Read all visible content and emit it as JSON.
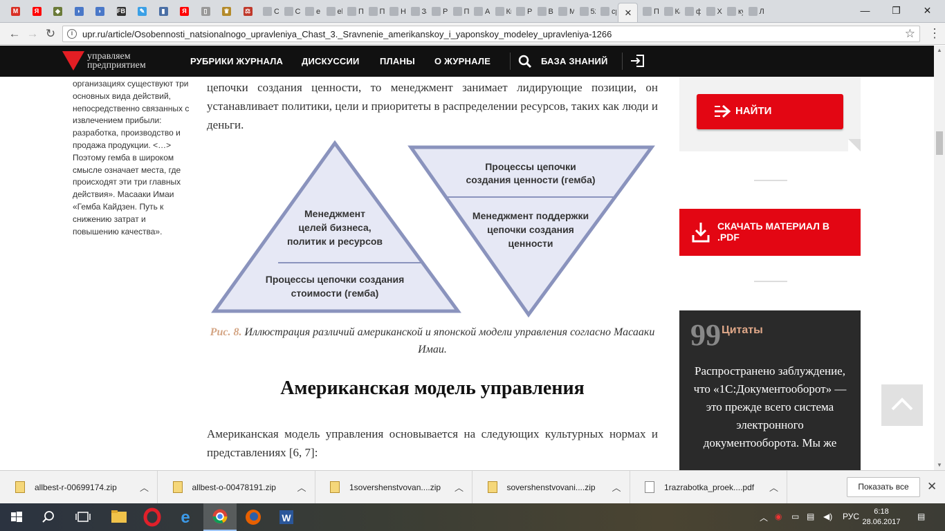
{
  "browser": {
    "tabs": [
      {
        "label": "",
        "icon": "gmail-icon",
        "color": "#d93025",
        "glyph": "M"
      },
      {
        "label": "",
        "icon": "yandex-icon",
        "color": "#ff0000",
        "glyph": "Я"
      },
      {
        "label": "",
        "icon": "shield-icon",
        "color": "#6b7b3a",
        "glyph": "◆"
      },
      {
        "label": "",
        "icon": "shield-blue-icon",
        "color": "#4a78c8",
        "glyph": "◗"
      },
      {
        "label": "",
        "icon": "shield-blue-icon",
        "color": "#4a78c8",
        "glyph": "◗"
      },
      {
        "label": "",
        "icon": "fb-icon",
        "color": "#333333",
        "glyph": "FB"
      },
      {
        "label": "",
        "icon": "pencil-icon",
        "color": "#3ba0e6",
        "glyph": "✎"
      },
      {
        "label": "",
        "icon": "bookmark-icon",
        "color": "#4a6fa5",
        "glyph": "▮"
      },
      {
        "label": "",
        "icon": "yandex-icon",
        "color": "#ff0000",
        "glyph": "Я"
      },
      {
        "label": "",
        "icon": "page-icon",
        "color": "#999999",
        "glyph": "▯"
      },
      {
        "label": "",
        "icon": "emblem-icon",
        "color": "#b48a2a",
        "glyph": "♛"
      },
      {
        "label": "",
        "icon": "scales-icon",
        "color": "#c0392b",
        "glyph": "⚖"
      },
      {
        "label": "Ст",
        "icon": "",
        "color": "",
        "glyph": ""
      },
      {
        "label": "Си",
        "icon": "",
        "color": "",
        "glyph": ""
      },
      {
        "label": "eL",
        "icon": "",
        "color": "",
        "glyph": ""
      },
      {
        "label": "eli",
        "icon": "",
        "color": "",
        "glyph": ""
      },
      {
        "label": "По",
        "icon": "",
        "color": "",
        "glyph": ""
      },
      {
        "label": "По",
        "icon": "",
        "color": "",
        "glyph": ""
      },
      {
        "label": "На",
        "icon": "",
        "color": "",
        "glyph": ""
      },
      {
        "label": "За",
        "icon": "",
        "color": "",
        "glyph": ""
      },
      {
        "label": "Ра",
        "icon": "",
        "color": "",
        "glyph": ""
      },
      {
        "label": "Пр",
        "icon": "",
        "color": "",
        "glyph": ""
      },
      {
        "label": "Ак",
        "icon": "",
        "color": "",
        "glyph": ""
      },
      {
        "label": "Ки",
        "icon": "",
        "color": "",
        "glyph": ""
      },
      {
        "label": "Ре",
        "icon": "",
        "color": "",
        "glyph": ""
      },
      {
        "label": "Вы",
        "icon": "",
        "color": "",
        "glyph": ""
      },
      {
        "label": "Ме",
        "icon": "",
        "color": "",
        "glyph": ""
      },
      {
        "label": "52",
        "icon": "",
        "color": "",
        "glyph": ""
      },
      {
        "label": "ср",
        "icon": "",
        "color": "",
        "glyph": ""
      },
      {
        "label": "✕",
        "icon": "close-icon",
        "color": "",
        "glyph": "",
        "active": true
      },
      {
        "label": "Пр",
        "icon": "",
        "color": "",
        "glyph": ""
      },
      {
        "label": "Ка",
        "icon": "",
        "color": "",
        "glyph": ""
      },
      {
        "label": "фо",
        "icon": "",
        "color": "",
        "glyph": ""
      },
      {
        "label": "Ха",
        "icon": "",
        "color": "",
        "glyph": ""
      },
      {
        "label": "кур",
        "icon": "",
        "color": "",
        "glyph": ""
      },
      {
        "label": "Ле",
        "icon": "",
        "color": "",
        "glyph": ""
      }
    ],
    "window_controls": {
      "minimize": "—",
      "restore": "❐",
      "close": "✕"
    },
    "url": "upr.ru/article/Osobennosti_natsionalnogo_upravleniya_Chast_3._Sravnenie_amerikanskoy_i_yaponskoy_modeley_upravleniya-1266",
    "info_glyph": "i",
    "star_glyph": "☆",
    "menu_glyph": "⋮",
    "back_glyph": "←",
    "forward_glyph": "→",
    "reload_glyph": "↻"
  },
  "site": {
    "logo_line1": "управляем",
    "logo_line2": "предприятием",
    "nav": [
      "РУБРИКИ ЖУРНАЛА",
      "ДИСКУССИИ",
      "ПЛАНЫ",
      "О ЖУРНАЛЕ",
      "БАЗА ЗНАНИЙ"
    ],
    "accent": "#e30613"
  },
  "sidebar_left": {
    "quote": "организациях существуют три основных вида действий, непосредственно связанных с извлечением прибыли: разработка, производство и продажа продукции. <…> Поэтому гемба в широком смысле означает места, где происходят эти три главных действия». Масааки Имаи «Гемба Кайдзен. Путь к снижению затрат и повышению качества»."
  },
  "article": {
    "para_top": "цепочки создания ценности, то менеджмент занимает лидирующие позиции, он устанавливает политики, цели и приоритеты в распределении ресурсов, таких как люди и деньги.",
    "figure": {
      "left_top_text": [
        "Менеджмент",
        "целей бизнеса,",
        "политик и ресурсов"
      ],
      "left_bottom_text": [
        "Процессы цепочки создания",
        "стоимости (гемба)"
      ],
      "right_top_text": [
        "Процессы цепочки",
        "создания ценности (гемба)"
      ],
      "right_bottom_text": [
        "Менеджмент поддержки",
        "цепочки создания",
        "ценности"
      ],
      "fill": "#e6e8f5",
      "stroke": "#8a93bd"
    },
    "caption_num": "Рис. 8.",
    "caption_text": " Иллюстрация различий американской и японской модели управления согласно Масааки Имаи.",
    "heading": "Американская модель управления",
    "para_bottom": "Американская модель управления основывается на следующих культурных нормах и представлениях [6, 7]:"
  },
  "sidebar_right": {
    "find_label": "НАЙТИ",
    "pdf_label": "СКАЧАТЬ МАТЕРИАЛ В .PDF",
    "quotes_mark": "99",
    "quotes_title": "Цитаты",
    "quotes_body": "Распространено заблуждение, что «1С:Документооборот» — это прежде всего система электронного документооборота. Мы же"
  },
  "downloads": {
    "items": [
      {
        "name": "allbest-r-00699174.zip",
        "type": "zip"
      },
      {
        "name": "allbest-o-00478191.zip",
        "type": "zip"
      },
      {
        "name": "1sovershenstvovan....zip",
        "type": "zip"
      },
      {
        "name": "sovershenstvovani....zip",
        "type": "zip"
      },
      {
        "name": "1razrabotka_proek....pdf",
        "type": "pdf"
      }
    ],
    "show_all": "Показать все",
    "close_glyph": "✕",
    "chevron_glyph": "︿"
  },
  "taskbar": {
    "lang": "РУС",
    "time": "6:18",
    "date": "28.06.2017"
  }
}
